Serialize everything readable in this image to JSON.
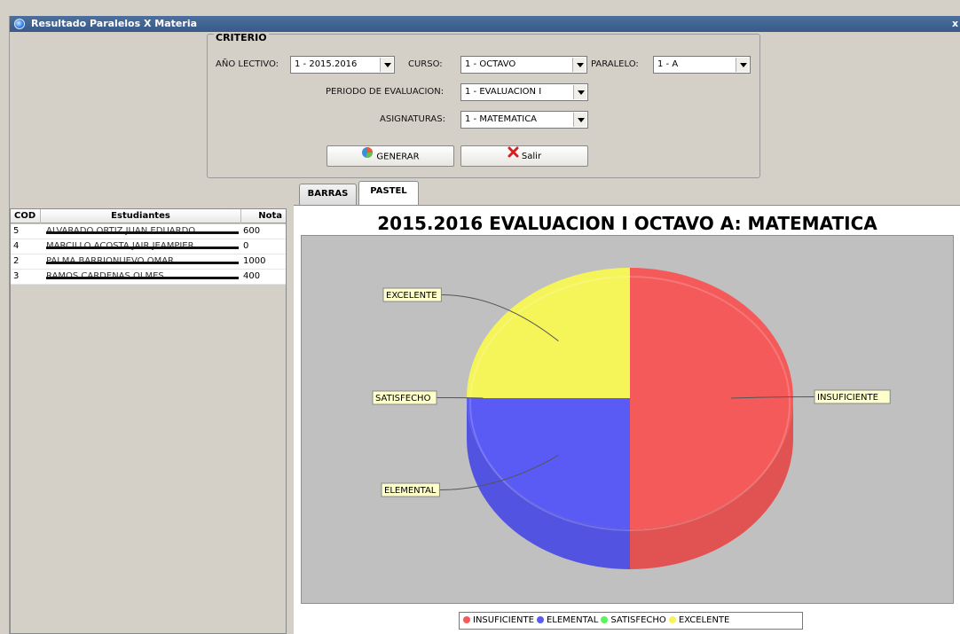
{
  "window": {
    "title": "Resultado Paralelos X Materia",
    "close_glyph": "x"
  },
  "criterio": {
    "legend": "CRITERIO",
    "anio_label": "AÑO LECTIVO:",
    "anio_value": "1 - 2015.2016",
    "curso_label": "CURSO:",
    "curso_value": "1 - OCTAVO",
    "paralelo_label": "PARALELO:",
    "paralelo_value": "1 - A",
    "periodo_label": "PERIODO DE EVALUACION:",
    "periodo_value": "1 - EVALUACION I",
    "asignaturas_label": "ASIGNATURAS:",
    "asignaturas_value": "1 - MATEMATICA",
    "generar_label": "GENERAR",
    "salir_label": "Salir"
  },
  "table": {
    "columns": [
      "COD",
      "Estudiantes",
      "Nota"
    ],
    "rows": [
      {
        "cod": "5",
        "name": "ALVARADO ORTIZ JUAN EDUARDO",
        "nota": "600"
      },
      {
        "cod": "4",
        "name": "MARCILLO ACOSTA JAIR JEAMPIER",
        "nota": "0"
      },
      {
        "cod": "2",
        "name": "PALMA BARRIONUEVO OMAR",
        "nota": "1000"
      },
      {
        "cod": "3",
        "name": "RAMOS CARDENAS OLMES",
        "nota": "400"
      }
    ]
  },
  "tabs": [
    "BARRAS",
    "PASTEL"
  ],
  "active_tab": "PASTEL",
  "chart_data": {
    "type": "pie",
    "title": "2015.2016 EVALUACION I OCTAVO A:  MATEMATICA",
    "categories": [
      "INSUFICIENTE",
      "ELEMENTAL",
      "SATISFECHO",
      "EXCELENTE"
    ],
    "values": [
      50,
      25,
      0,
      25
    ],
    "colors": [
      "#f55a5a",
      "#5a5af5",
      "#5af55a",
      "#f5f55a"
    ],
    "legend_position": "bottom",
    "background": "#c0c0c0"
  }
}
